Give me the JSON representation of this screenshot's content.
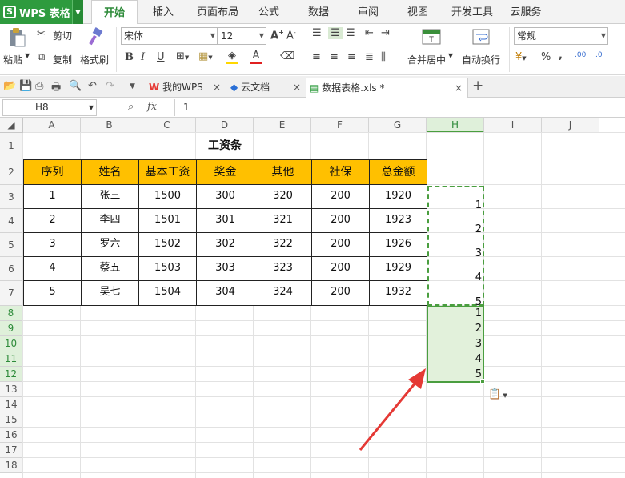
{
  "app": {
    "name": "WPS 表格"
  },
  "menu": {
    "tabs": [
      "开始",
      "插入",
      "页面布局",
      "公式",
      "数据",
      "审阅",
      "视图",
      "开发工具",
      "云服务"
    ],
    "active": "开始"
  },
  "ribbon": {
    "paste": "粘贴",
    "cut": "剪切",
    "copy": "复制",
    "format_painter": "格式刷",
    "font_name": "宋体",
    "font_size": "12",
    "merge_center": "合并居中",
    "wrap_text": "自动换行",
    "number_format": "常规",
    "percent": "%",
    "comma": ",",
    "dec_add": ".00",
    "dec_remove": ".0"
  },
  "doc_tabs": [
    {
      "label": "我的WPS",
      "icon": "wps-logo-icon"
    },
    {
      "label": "云文档",
      "icon": "cloud-icon"
    },
    {
      "label": "数据表格.xls *",
      "icon": "spreadsheet-icon",
      "active": true
    }
  ],
  "formula_bar": {
    "cell_ref": "H8",
    "value": "1"
  },
  "columns": [
    "A",
    "B",
    "C",
    "D",
    "E",
    "F",
    "G",
    "H",
    "I",
    "J"
  ],
  "rows": [
    "1",
    "2",
    "3",
    "4",
    "5",
    "6",
    "7",
    "8",
    "9",
    "10",
    "11",
    "12",
    "13",
    "14",
    "15",
    "16",
    "17",
    "18"
  ],
  "sheet": {
    "title": "工资条",
    "headers": [
      "序列",
      "姓名",
      "基本工资",
      "奖金",
      "其他",
      "社保",
      "总金额"
    ],
    "rows": [
      [
        "1",
        "张三",
        "1500",
        "300",
        "320",
        "200",
        "1920"
      ],
      [
        "2",
        "李四",
        "1501",
        "301",
        "321",
        "200",
        "1923"
      ],
      [
        "3",
        "罗六",
        "1502",
        "302",
        "322",
        "200",
        "1926"
      ],
      [
        "4",
        "蔡五",
        "1503",
        "303",
        "323",
        "200",
        "1929"
      ],
      [
        "5",
        "吴七",
        "1504",
        "304",
        "324",
        "200",
        "1932"
      ]
    ],
    "h_col_copied": [
      "1",
      "2",
      "3",
      "4",
      "5"
    ],
    "h_col_pasted": [
      "1",
      "2",
      "3",
      "4",
      "5"
    ]
  },
  "colors": {
    "accent": "#2e9b3e",
    "header_fill": "#ffc000",
    "selection": "#4a9e3f",
    "arrow": "#e53935"
  }
}
